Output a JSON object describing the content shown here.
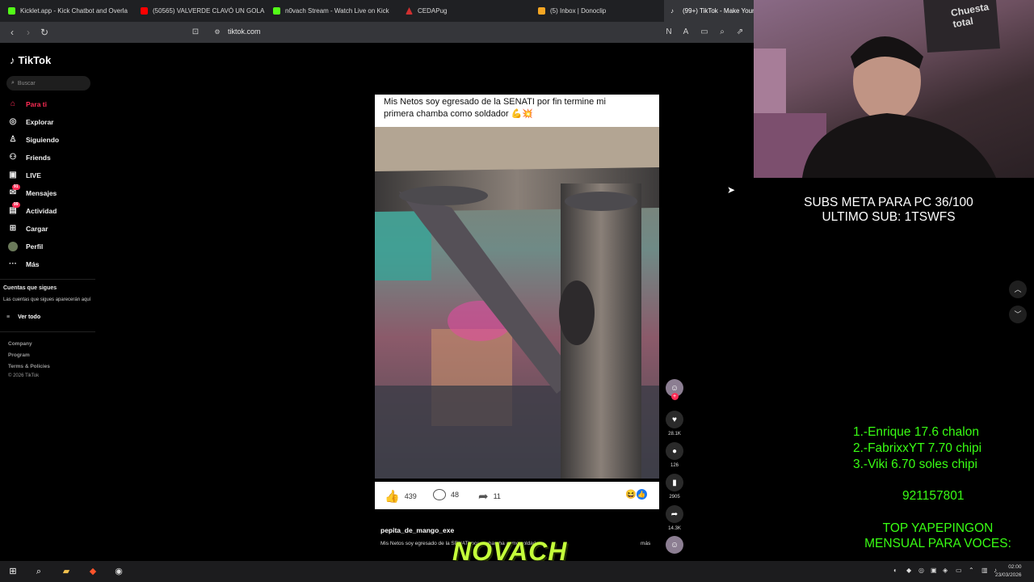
{
  "tabs": [
    {
      "label": "Kicklet.app - Kick Chatbot and Overla",
      "color": "#53fc18"
    },
    {
      "label": "(50565) VALVERDE CLAVÓ UN GOLA",
      "color": "#ff0000"
    },
    {
      "label": "n0vach Stream - Watch Live on Kick",
      "color": "#53fc18"
    },
    {
      "label": "CEDAPug",
      "color": "#d03030"
    },
    {
      "label": "(5) Inbox | Donoclip",
      "color": "#f5a623"
    },
    {
      "label": "(99+) TikTok - Make Your",
      "color": "#ffffff"
    }
  ],
  "browser": {
    "url": "tiktok.com"
  },
  "tiktok": {
    "logo": "TikTok",
    "search_placeholder": "Buscar",
    "nav": [
      {
        "label": "Para ti",
        "icon": "home-icon"
      },
      {
        "label": "Explorar",
        "icon": "compass-icon"
      },
      {
        "label": "Siguiendo",
        "icon": "following-icon"
      },
      {
        "label": "Friends",
        "icon": "friends-icon"
      },
      {
        "label": "LIVE",
        "icon": "live-icon"
      },
      {
        "label": "Mensajes",
        "icon": "messages-icon",
        "badge": "91"
      },
      {
        "label": "Actividad",
        "icon": "activity-icon",
        "badge": "99"
      },
      {
        "label": "Cargar",
        "icon": "upload-icon"
      },
      {
        "label": "Perfil",
        "icon": "profile-avatar-icon"
      },
      {
        "label": "Más",
        "icon": "more-icon"
      }
    ],
    "following_title": "Cuentas que sigues",
    "following_desc": "Las cuentas que sigues aparecerán aquí",
    "see_all": "Ver todo",
    "footer": [
      "Company",
      "Program",
      "Terms & Policies"
    ],
    "copyright": "© 2026 TikTok"
  },
  "post": {
    "caption_line1": "Mis Netos soy egresado de  la SENATI por fin termine mi",
    "caption_line2": "primera chamba como soldador 💪💥",
    "likes": "439",
    "comments": "48",
    "shares": "11",
    "author": "pepita_de_mango_exe",
    "description": "Mis Netos soy egresado de la SENATI por ... chamba como soldador...",
    "more": "más"
  },
  "actions": {
    "likes": "28.1K",
    "comments": "126",
    "saves": "2905",
    "shares": "14.3K"
  },
  "stream": {
    "meta_line1": "SUBS META PARA PC 36/100",
    "meta_line2": "ULTIMO SUB: 1TSWFS",
    "tips": [
      "1.-Enrique 17.6 chalon",
      "2.-FabrixxYT 7.70 chipi",
      "3.-Viki 6.70 soles chipi"
    ],
    "phone": "921157801",
    "top_line1": "TOP YAPEPINGON",
    "top_line2": "MENSUAL PARA VOCES:",
    "watermark": "NOVACH",
    "shirt_text": "Chuesta total"
  },
  "taskbar": {
    "time": "02:00",
    "date": "23/03/2026"
  }
}
